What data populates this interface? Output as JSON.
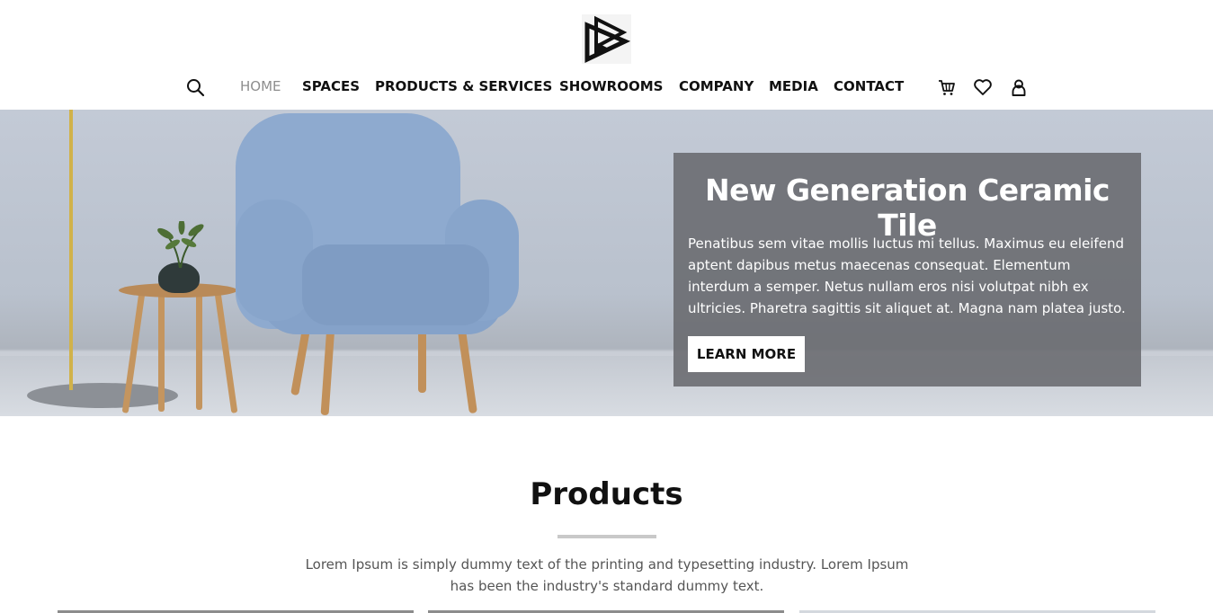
{
  "nav": {
    "items": [
      {
        "label": "HOME",
        "active": true
      },
      {
        "label": "SPACES",
        "active": false
      },
      {
        "label": "PRODUCTS & SERVICES",
        "active": false
      },
      {
        "label": "SHOWROOMS",
        "active": false
      },
      {
        "label": "COMPANY",
        "active": false
      },
      {
        "label": "MEDIA",
        "active": false
      },
      {
        "label": "CONTACT",
        "active": false
      }
    ],
    "icons": [
      "search-icon",
      "cart-icon",
      "heart-icon",
      "user-icon"
    ]
  },
  "hero": {
    "title": "New Generation Ceramic Tile",
    "text": "Penatibus sem vitae mollis luctus mi tellus. Maximus eu eleifend aptent dapibus metus maecenas consequat. Elementum interdum a semper. Netus nullam eros nisi volutpat nibh ex ultricies. Pharetra sagittis sit aliquet at. Magna nam platea justo.",
    "button_label": "LEARN MORE"
  },
  "products": {
    "title": "Products",
    "description": "Lorem Ipsum is simply dummy text of the printing and typesetting industry. Lorem Ipsum has been the industry's standard dummy text."
  },
  "colors": {
    "accent_active_nav": "#8d8d8d",
    "hero_card": "#66686c",
    "text": "#111111"
  }
}
